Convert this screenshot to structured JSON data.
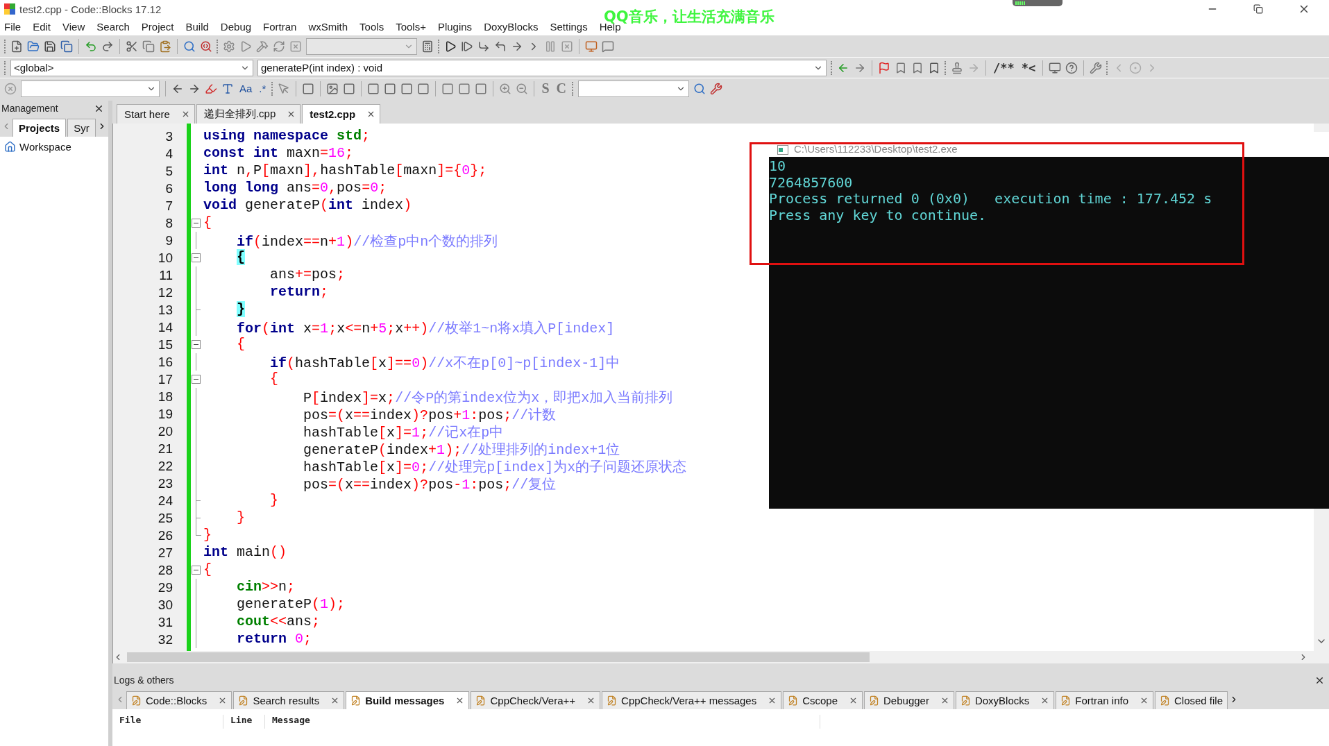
{
  "window": {
    "title": "test2.cpp - Code::Blocks 17.12"
  },
  "overlay_text": "QQ音乐，让生活充满音乐",
  "menu": [
    "File",
    "Edit",
    "View",
    "Search",
    "Project",
    "Build",
    "Debug",
    "Fortran",
    "wxSmith",
    "Tools",
    "Tools+",
    "Plugins",
    "DoxyBlocks",
    "Settings",
    "Help"
  ],
  "doc_toolbar": [
    "/**",
    "*<"
  ],
  "find_toolbar": [
    "Aa",
    ".*"
  ],
  "wx_toolbar": [
    "S",
    "C"
  ],
  "scope_bar": {
    "scope": "<global>",
    "function": "generateP(int index) : void"
  },
  "management": {
    "title": "Management",
    "tabs": [
      {
        "label": "Projects",
        "selected": true
      },
      {
        "label": "Syr",
        "selected": false
      }
    ],
    "tree": [
      {
        "label": "Workspace"
      }
    ]
  },
  "editor_tabs": [
    {
      "label": "Start here",
      "selected": false
    },
    {
      "label": "递归全排列.cpp",
      "selected": false
    },
    {
      "label": "test2.cpp",
      "selected": true
    }
  ],
  "code": [
    {
      "num": "3",
      "kind": "plain",
      "tokens": [
        {
          "kind": "kw",
          "text": "using "
        },
        {
          "kind": "kw",
          "text": "namespace "
        },
        {
          "kind": "lib",
          "text": "std"
        },
        {
          "kind": "op",
          "text": ";"
        }
      ]
    },
    {
      "num": "4",
      "kind": "plain",
      "tokens": [
        {
          "kind": "kw",
          "text": "const "
        },
        {
          "kind": "kw",
          "text": "int"
        },
        {
          "kind": "id",
          "text": " maxn"
        },
        {
          "kind": "op",
          "text": "="
        },
        {
          "kind": "num",
          "text": "16"
        },
        {
          "kind": "op",
          "text": ";"
        }
      ]
    },
    {
      "num": "5",
      "kind": "plain",
      "tokens": [
        {
          "kind": "kw",
          "text": "int"
        },
        {
          "kind": "id",
          "text": " n"
        },
        {
          "kind": "op",
          "text": ","
        },
        {
          "kind": "id",
          "text": "P"
        },
        {
          "kind": "op",
          "text": "["
        },
        {
          "kind": "id",
          "text": "maxn"
        },
        {
          "kind": "op",
          "text": "],"
        },
        {
          "kind": "id",
          "text": "hashTable"
        },
        {
          "kind": "op",
          "text": "["
        },
        {
          "kind": "id",
          "text": "maxn"
        },
        {
          "kind": "op",
          "text": "]={"
        },
        {
          "kind": "num",
          "text": "0"
        },
        {
          "kind": "op",
          "text": "};"
        }
      ]
    },
    {
      "num": "6",
      "kind": "plain",
      "tokens": [
        {
          "kind": "kw",
          "text": "long "
        },
        {
          "kind": "kw",
          "text": "long"
        },
        {
          "kind": "id",
          "text": " ans"
        },
        {
          "kind": "op",
          "text": "="
        },
        {
          "kind": "num",
          "text": "0"
        },
        {
          "kind": "op",
          "text": ","
        },
        {
          "kind": "id",
          "text": "pos"
        },
        {
          "kind": "op",
          "text": "="
        },
        {
          "kind": "num",
          "text": "0"
        },
        {
          "kind": "op",
          "text": ";"
        }
      ]
    },
    {
      "num": "7",
      "kind": "plain",
      "tokens": [
        {
          "kind": "kw",
          "text": "void"
        },
        {
          "kind": "id",
          "text": " generateP"
        },
        {
          "kind": "op",
          "text": "("
        },
        {
          "kind": "kw",
          "text": "int"
        },
        {
          "kind": "id",
          "text": " index"
        },
        {
          "kind": "op",
          "text": ")"
        }
      ]
    },
    {
      "num": "8",
      "kind": "fold_open",
      "tokens": [
        {
          "kind": "op",
          "text": "{"
        }
      ]
    },
    {
      "num": "9",
      "kind": "fold_line",
      "tokens": [
        {
          "kind": "kw",
          "text": "    if"
        },
        {
          "kind": "op",
          "text": "("
        },
        {
          "kind": "id",
          "text": "index"
        },
        {
          "kind": "op",
          "text": "=="
        },
        {
          "kind": "id",
          "text": "n"
        },
        {
          "kind": "op",
          "text": "+"
        },
        {
          "kind": "num",
          "text": "1"
        },
        {
          "kind": "op",
          "text": ")"
        },
        {
          "kind": "cm",
          "text": "//检查p中n个数的排列"
        }
      ]
    },
    {
      "num": "10",
      "kind": "fold_open",
      "tokens": [
        {
          "kind": "match",
          "text": "    {"
        }
      ]
    },
    {
      "num": "11",
      "kind": "fold_line",
      "tokens": [
        {
          "kind": "id",
          "text": "        ans"
        },
        {
          "kind": "op",
          "text": "+="
        },
        {
          "kind": "id",
          "text": "pos"
        },
        {
          "kind": "op",
          "text": ";"
        }
      ]
    },
    {
      "num": "12",
      "kind": "fold_line",
      "tokens": [
        {
          "kind": "kw",
          "text": "        return"
        },
        {
          "kind": "op",
          "text": ";"
        }
      ]
    },
    {
      "num": "13",
      "kind": "fold_end",
      "tokens": [
        {
          "kind": "match",
          "text": "    }"
        }
      ]
    },
    {
      "num": "14",
      "kind": "fold_line",
      "tokens": [
        {
          "kind": "kw",
          "text": "    for"
        },
        {
          "kind": "op",
          "text": "("
        },
        {
          "kind": "kw",
          "text": "int"
        },
        {
          "kind": "id",
          "text": " x"
        },
        {
          "kind": "op",
          "text": "="
        },
        {
          "kind": "num",
          "text": "1"
        },
        {
          "kind": "op",
          "text": ";"
        },
        {
          "kind": "id",
          "text": "x"
        },
        {
          "kind": "op",
          "text": "<="
        },
        {
          "kind": "id",
          "text": "n"
        },
        {
          "kind": "op",
          "text": "+"
        },
        {
          "kind": "num",
          "text": "5"
        },
        {
          "kind": "op",
          "text": ";"
        },
        {
          "kind": "id",
          "text": "x"
        },
        {
          "kind": "op",
          "text": "++)"
        },
        {
          "kind": "cm",
          "text": "//枚举1~n将x填入P[index]"
        }
      ]
    },
    {
      "num": "15",
      "kind": "fold_open",
      "tokens": [
        {
          "kind": "op",
          "text": "    {"
        }
      ]
    },
    {
      "num": "16",
      "kind": "fold_line",
      "tokens": [
        {
          "kind": "kw",
          "text": "        if"
        },
        {
          "kind": "op",
          "text": "("
        },
        {
          "kind": "id",
          "text": "hashTable"
        },
        {
          "kind": "op",
          "text": "["
        },
        {
          "kind": "id",
          "text": "x"
        },
        {
          "kind": "op",
          "text": "]=="
        },
        {
          "kind": "num",
          "text": "0"
        },
        {
          "kind": "op",
          "text": ")"
        },
        {
          "kind": "cm",
          "text": "//x不在p[0]~p[index-1]中"
        }
      ]
    },
    {
      "num": "17",
      "kind": "fold_open",
      "tokens": [
        {
          "kind": "op",
          "text": "        {"
        }
      ]
    },
    {
      "num": "18",
      "kind": "fold_line",
      "tokens": [
        {
          "kind": "id",
          "text": "            P"
        },
        {
          "kind": "op",
          "text": "["
        },
        {
          "kind": "id",
          "text": "index"
        },
        {
          "kind": "op",
          "text": "]="
        },
        {
          "kind": "id",
          "text": "x"
        },
        {
          "kind": "op",
          "text": ";"
        },
        {
          "kind": "cm",
          "text": "//令P的第index位为x，即把x加入当前排列"
        }
      ]
    },
    {
      "num": "19",
      "kind": "fold_line",
      "tokens": [
        {
          "kind": "id",
          "text": "            pos"
        },
        {
          "kind": "op",
          "text": "=("
        },
        {
          "kind": "id",
          "text": "x"
        },
        {
          "kind": "op",
          "text": "=="
        },
        {
          "kind": "id",
          "text": "index"
        },
        {
          "kind": "op",
          "text": ")?"
        },
        {
          "kind": "id",
          "text": "pos"
        },
        {
          "kind": "op",
          "text": "+"
        },
        {
          "kind": "num",
          "text": "1"
        },
        {
          "kind": "op",
          "text": ":"
        },
        {
          "kind": "id",
          "text": "pos"
        },
        {
          "kind": "op",
          "text": ";"
        },
        {
          "kind": "cm",
          "text": "//计数"
        }
      ]
    },
    {
      "num": "20",
      "kind": "fold_line",
      "tokens": [
        {
          "kind": "id",
          "text": "            hashTable"
        },
        {
          "kind": "op",
          "text": "["
        },
        {
          "kind": "id",
          "text": "x"
        },
        {
          "kind": "op",
          "text": "]="
        },
        {
          "kind": "num",
          "text": "1"
        },
        {
          "kind": "op",
          "text": ";"
        },
        {
          "kind": "cm",
          "text": "//记x在p中"
        }
      ]
    },
    {
      "num": "21",
      "kind": "fold_line",
      "tokens": [
        {
          "kind": "id",
          "text": "            generateP"
        },
        {
          "kind": "op",
          "text": "("
        },
        {
          "kind": "id",
          "text": "index"
        },
        {
          "kind": "op",
          "text": "+"
        },
        {
          "kind": "num",
          "text": "1"
        },
        {
          "kind": "op",
          "text": ");"
        },
        {
          "kind": "cm",
          "text": "//处理排列的index+1位"
        }
      ]
    },
    {
      "num": "22",
      "kind": "fold_line",
      "tokens": [
        {
          "kind": "id",
          "text": "            hashTable"
        },
        {
          "kind": "op",
          "text": "["
        },
        {
          "kind": "id",
          "text": "x"
        },
        {
          "kind": "op",
          "text": "]="
        },
        {
          "kind": "num",
          "text": "0"
        },
        {
          "kind": "op",
          "text": ";"
        },
        {
          "kind": "cm",
          "text": "//处理完p[index]为x的子问题还原状态"
        }
      ]
    },
    {
      "num": "23",
      "kind": "fold_line",
      "tokens": [
        {
          "kind": "id",
          "text": "            pos"
        },
        {
          "kind": "op",
          "text": "=("
        },
        {
          "kind": "id",
          "text": "x"
        },
        {
          "kind": "op",
          "text": "=="
        },
        {
          "kind": "id",
          "text": "index"
        },
        {
          "kind": "op",
          "text": ")?"
        },
        {
          "kind": "id",
          "text": "pos"
        },
        {
          "kind": "op",
          "text": "-"
        },
        {
          "kind": "num",
          "text": "1"
        },
        {
          "kind": "op",
          "text": ":"
        },
        {
          "kind": "id",
          "text": "pos"
        },
        {
          "kind": "op",
          "text": ";"
        },
        {
          "kind": "cm",
          "text": "//复位"
        }
      ]
    },
    {
      "num": "24",
      "kind": "fold_end",
      "tokens": [
        {
          "kind": "op",
          "text": "        }"
        }
      ]
    },
    {
      "num": "25",
      "kind": "fold_end",
      "tokens": [
        {
          "kind": "op",
          "text": "    }"
        }
      ]
    },
    {
      "num": "26",
      "kind": "fold_close",
      "tokens": [
        {
          "kind": "op",
          "text": "}"
        }
      ]
    },
    {
      "num": "27",
      "kind": "plain",
      "tokens": [
        {
          "kind": "kw",
          "text": "int"
        },
        {
          "kind": "id",
          "text": " main"
        },
        {
          "kind": "op",
          "text": "()"
        }
      ]
    },
    {
      "num": "28",
      "kind": "fold_open",
      "tokens": [
        {
          "kind": "op",
          "text": "{"
        }
      ]
    },
    {
      "num": "29",
      "kind": "fold_line",
      "tokens": [
        {
          "kind": "lib",
          "text": "    cin"
        },
        {
          "kind": "op",
          "text": ">>"
        },
        {
          "kind": "id",
          "text": "n"
        },
        {
          "kind": "op",
          "text": ";"
        }
      ]
    },
    {
      "num": "30",
      "kind": "fold_line",
      "tokens": [
        {
          "kind": "id",
          "text": "    generateP"
        },
        {
          "kind": "op",
          "text": "("
        },
        {
          "kind": "num",
          "text": "1"
        },
        {
          "kind": "op",
          "text": ");"
        }
      ]
    },
    {
      "num": "31",
      "kind": "fold_line",
      "tokens": [
        {
          "kind": "lib",
          "text": "    cout"
        },
        {
          "kind": "op",
          "text": "<<"
        },
        {
          "kind": "id",
          "text": "ans"
        },
        {
          "kind": "op",
          "text": ";"
        }
      ]
    },
    {
      "num": "32",
      "kind": "fold_line",
      "tokens": [
        {
          "kind": "kw",
          "text": "    return "
        },
        {
          "kind": "num",
          "text": "0"
        },
        {
          "kind": "op",
          "text": ";"
        }
      ]
    }
  ],
  "console": {
    "title": "C:\\Users\\112233\\Desktop\\test2.exe",
    "lines": [
      "10",
      "7264857600",
      "Process returned 0 (0x0)   execution time : 177.452 s",
      "Press any key to continue."
    ]
  },
  "logs": {
    "title": "Logs & others",
    "tabs": [
      {
        "label": "Code::Blocks",
        "selected": false
      },
      {
        "label": "Search results",
        "selected": false
      },
      {
        "label": "Build messages",
        "selected": true
      },
      {
        "label": "CppCheck/Vera++",
        "selected": false
      },
      {
        "label": "CppCheck/Vera++ messages",
        "selected": false
      },
      {
        "label": "Cscope",
        "selected": false
      },
      {
        "label": "Debugger",
        "selected": false
      },
      {
        "label": "DoxyBlocks",
        "selected": false
      },
      {
        "label": "Fortran info",
        "selected": false
      },
      {
        "label": "Closed file",
        "selected": false
      }
    ],
    "columns": [
      "File",
      "Line",
      "Message"
    ]
  }
}
